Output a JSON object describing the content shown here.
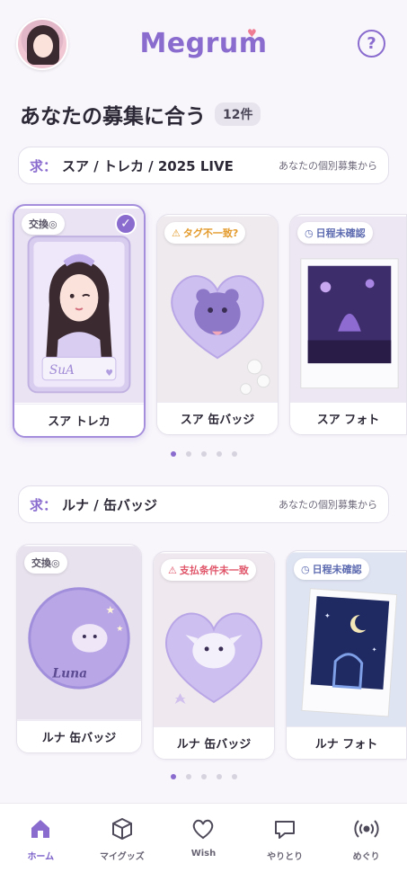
{
  "header": {
    "logo": "Megrum",
    "help_icon": "?"
  },
  "main": {
    "title": "あなたの募集に合う",
    "count": "12件"
  },
  "sections": [
    {
      "prefix": "求：",
      "request": "スア / トレカ / 2025 LIVE",
      "note": "あなたの個別募集から",
      "cards": [
        {
          "label": "スア トレカ",
          "tag": "交換◎",
          "tag_type": "exchange",
          "selected": true
        },
        {
          "label": "スア 缶バッジ",
          "tag": "タグ不一致?",
          "tag_type": "warn",
          "selected": false
        },
        {
          "label": "スア フォト",
          "tag": "日程未確認",
          "tag_type": "schedule",
          "selected": false
        }
      ],
      "pagination": {
        "total": 5,
        "active": 1
      }
    },
    {
      "prefix": "求：",
      "request": "ルナ / 缶バッジ",
      "note": "あなたの個別募集から",
      "cards": [
        {
          "label": "ルナ 缶バッジ",
          "tag": "交換◎",
          "tag_type": "exchange",
          "selected": false
        },
        {
          "label": "ルナ 缶バッジ",
          "tag": "支払条件未一致",
          "tag_type": "error",
          "selected": false
        },
        {
          "label": "ルナ フォト",
          "tag": "日程未確認",
          "tag_type": "schedule",
          "selected": false
        }
      ],
      "pagination": {
        "total": 5,
        "active": 1
      }
    }
  ],
  "card_text": {
    "photocard_name": "SuA",
    "badge_name": "Luna"
  },
  "bottom_nav": [
    {
      "label": "ホーム",
      "icon": "home-icon",
      "active": true
    },
    {
      "label": "マイグッズ",
      "icon": "box-icon",
      "active": false
    },
    {
      "label": "Wish",
      "icon": "heart-icon",
      "active": false
    },
    {
      "label": "やりとり",
      "icon": "chat-icon",
      "active": false
    },
    {
      "label": "めぐり",
      "icon": "radar-icon",
      "active": false
    }
  ],
  "colors": {
    "accent": "#8a6ccf",
    "background": "#f8f6fb",
    "warn": "#e39a2b",
    "error": "#e0566a",
    "schedule": "#5d6bb0"
  }
}
